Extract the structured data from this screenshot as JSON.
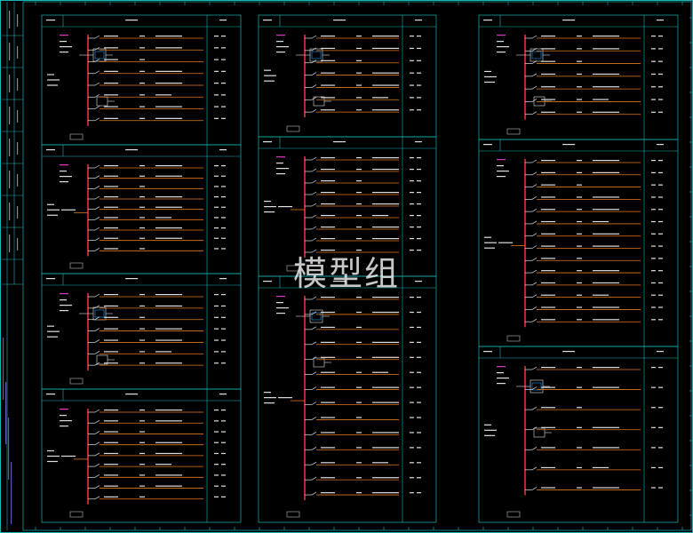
{
  "watermark": "模型组",
  "colors": {
    "background": "#000000",
    "frame": "#19b5b5",
    "wire": "#e07a1f",
    "label": "#e0e0e0",
    "accent": "#d93abd",
    "device": "#1e9bff",
    "busbar": "#ff3b3b",
    "tag": "#8a8a8a"
  }
}
